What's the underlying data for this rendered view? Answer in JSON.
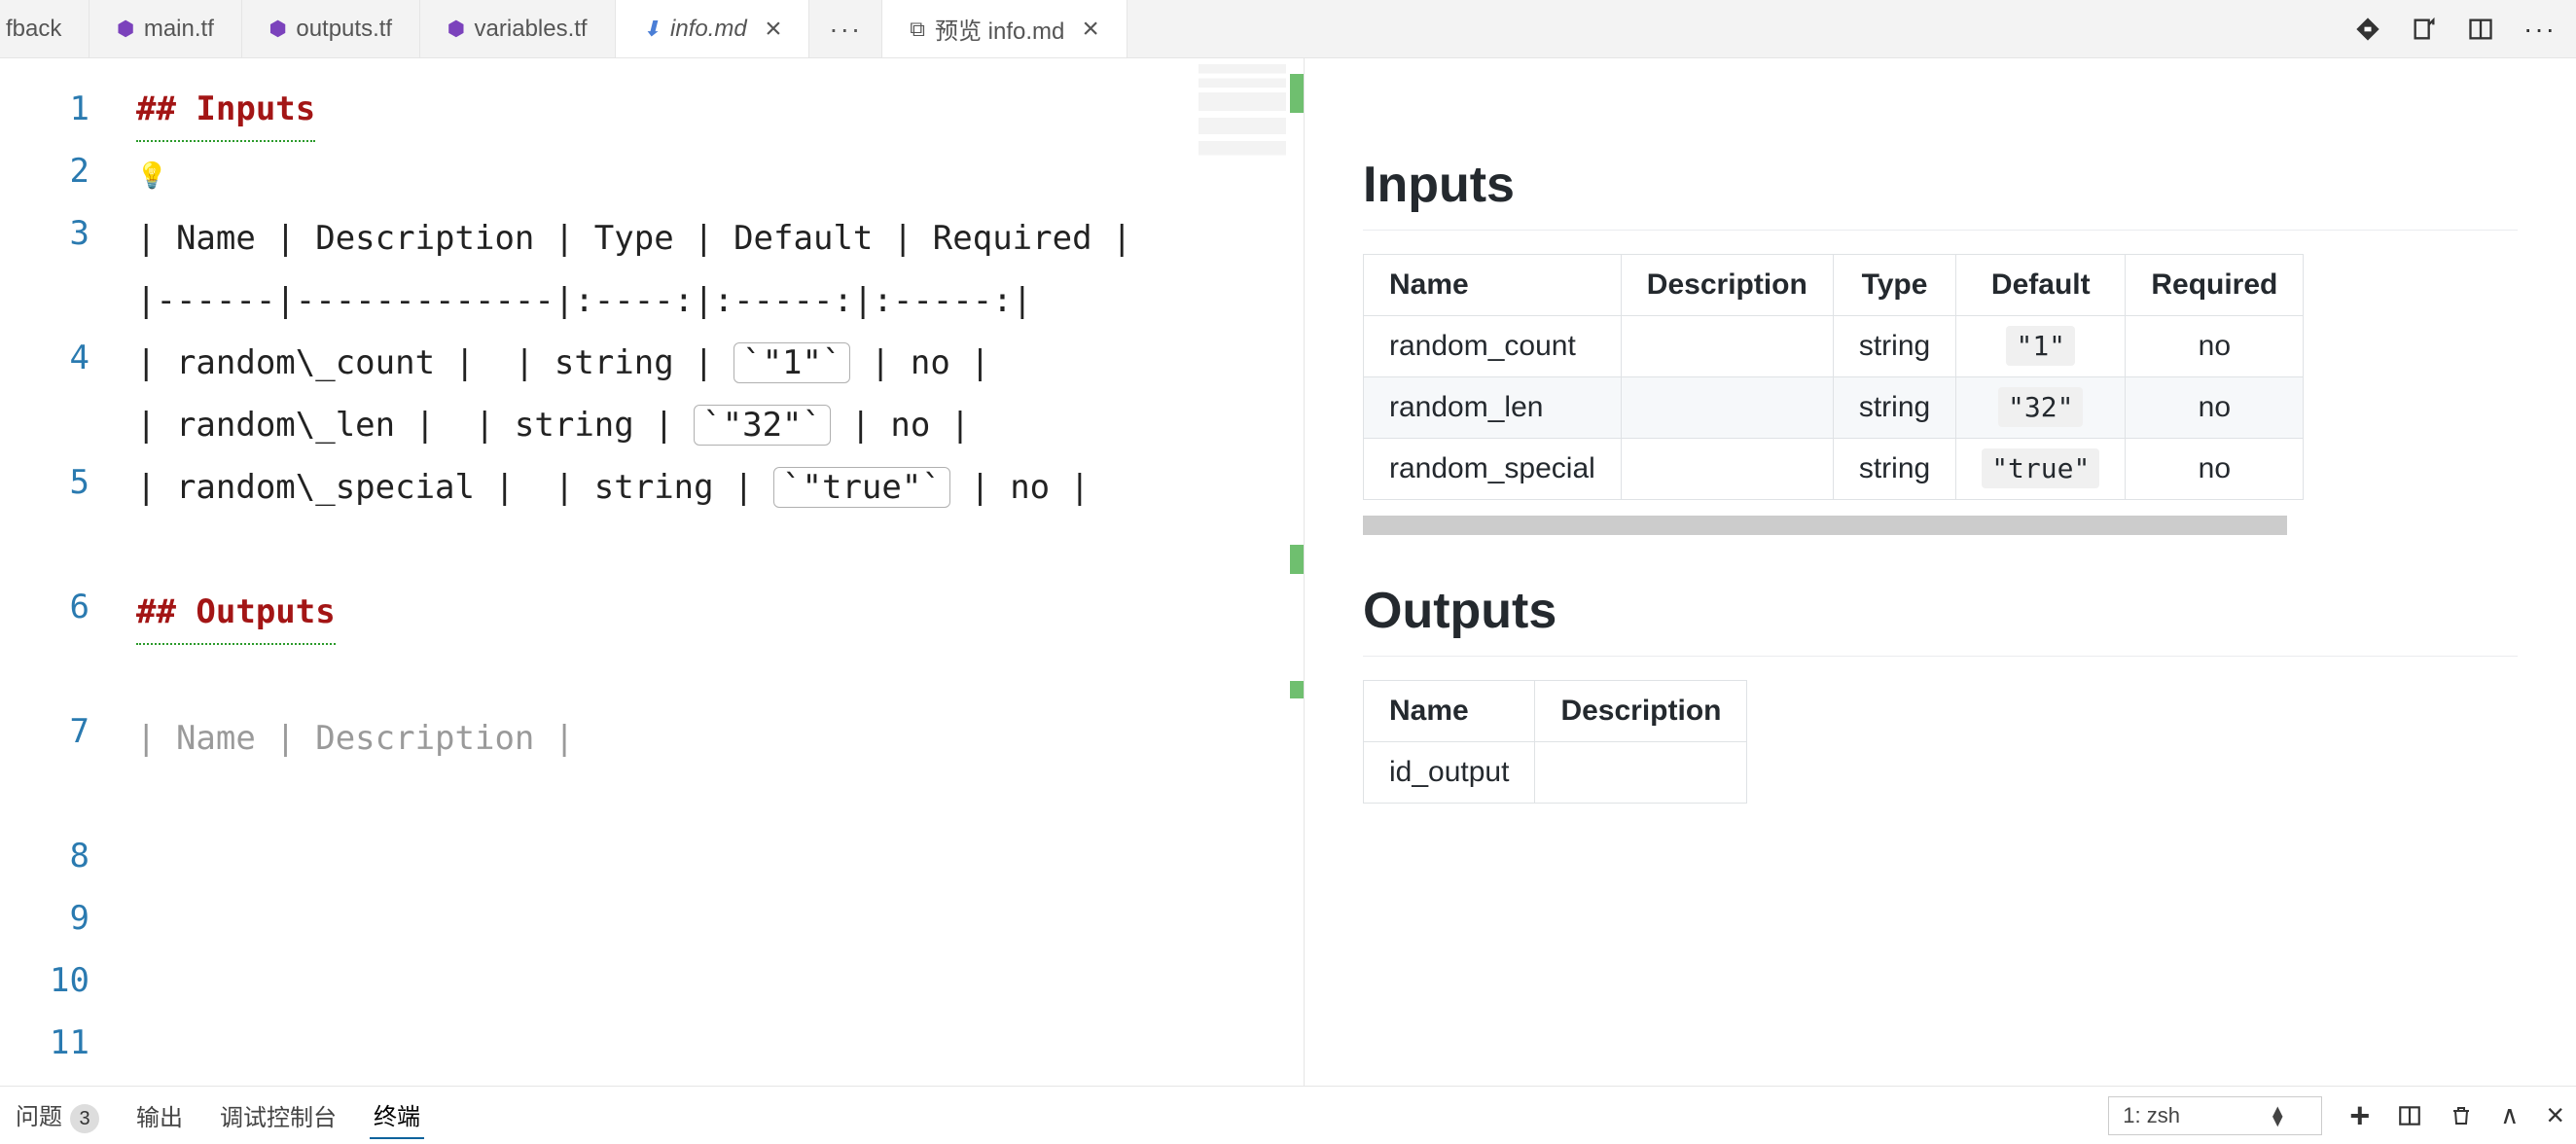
{
  "tabs": {
    "items": [
      {
        "label": "fback",
        "icon": ""
      },
      {
        "label": "main.tf",
        "icon": "tf"
      },
      {
        "label": "outputs.tf",
        "icon": "tf"
      },
      {
        "label": "variables.tf",
        "icon": "tf"
      },
      {
        "label": "info.md",
        "icon": "md",
        "active": true,
        "close": true
      },
      {
        "label": "预览 info.md",
        "icon": "pv",
        "close": true
      }
    ],
    "overflow": "···"
  },
  "editor": {
    "lines": [
      "1",
      "2",
      "3",
      "4",
      "5",
      "6",
      "7",
      "8",
      "9",
      "10",
      "11"
    ],
    "l1": "## Inputs",
    "l2_bulb": "💡",
    "l3": "| Name | Description | Type | Default | Required |",
    "l4": "|------|-------------|:----:|:-----:|:-----:|",
    "l5_a": "| random\\_count |  | string | ",
    "l5_code": "`\"1\"`",
    "l5_b": " | no |",
    "l6_a": "| random\\_len |  | string | ",
    "l6_code": "`\"32\"`",
    "l6_b": " | no |",
    "l7_a": "| random\\_special |  | string | ",
    "l7_code": "`\"true\"`",
    "l7_b": " | no |",
    "l8": "",
    "l9": "## Outputs",
    "l10": "",
    "l11": "| Name | Description |"
  },
  "preview": {
    "h_inputs": "Inputs",
    "h_outputs": "Outputs",
    "inputs_head": [
      "Name",
      "Description",
      "Type",
      "Default",
      "Required"
    ],
    "inputs_rows": [
      {
        "name": "random_count",
        "desc": "",
        "type": "string",
        "def": "\"1\"",
        "req": "no"
      },
      {
        "name": "random_len",
        "desc": "",
        "type": "string",
        "def": "\"32\"",
        "req": "no"
      },
      {
        "name": "random_special",
        "desc": "",
        "type": "string",
        "def": "\"true\"",
        "req": "no"
      }
    ],
    "outputs_head": [
      "Name",
      "Description"
    ],
    "outputs_rows": [
      {
        "name": "id_output",
        "desc": ""
      }
    ]
  },
  "panel": {
    "tabs": {
      "problems": "问题",
      "problems_count": "3",
      "output": "输出",
      "debug": "调试控制台",
      "terminal": "终端"
    },
    "terminal_select": "1: zsh"
  }
}
